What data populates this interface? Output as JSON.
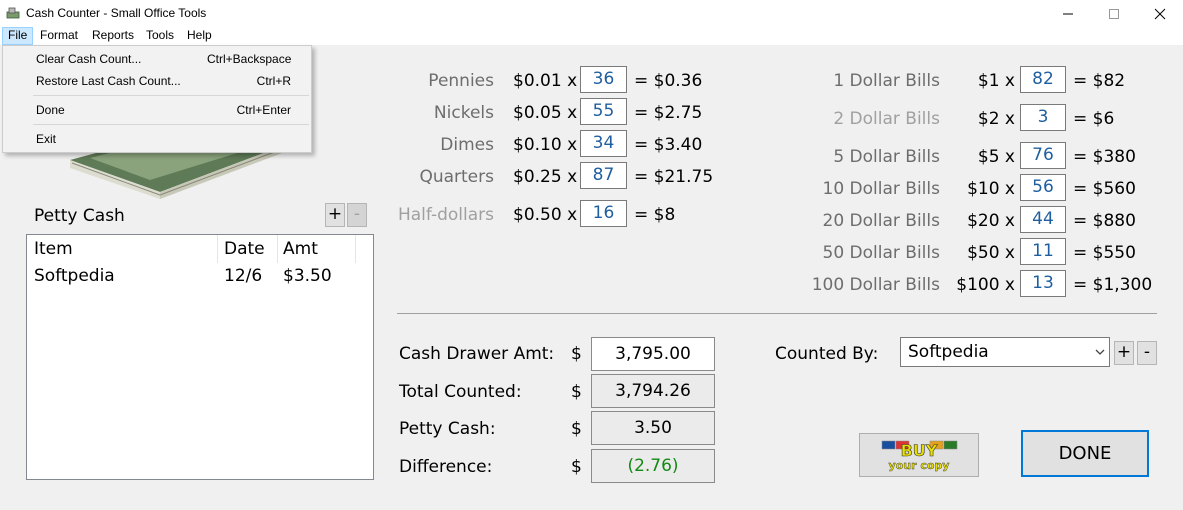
{
  "window": {
    "title": "Cash Counter - Small Office Tools"
  },
  "menubar": [
    "File",
    "Format",
    "Reports",
    "Tools",
    "Help"
  ],
  "file_menu": {
    "items": [
      {
        "label": "Clear Cash Count...",
        "shortcut": "Ctrl+Backspace"
      },
      {
        "label": "Restore Last Cash Count...",
        "shortcut": "Ctrl+R"
      },
      {
        "label": "Done",
        "shortcut": "Ctrl+Enter"
      },
      {
        "label": "Exit",
        "shortcut": ""
      }
    ]
  },
  "petty_cash": {
    "label": "Petty Cash",
    "add": "+",
    "remove": "-",
    "columns": [
      "Item",
      "Date",
      "Amt"
    ],
    "rows": [
      {
        "item": "Softpedia",
        "date": "12/6",
        "amt": "$3.50"
      }
    ]
  },
  "coins": [
    {
      "label": "Pennies",
      "price": "$0.01 x",
      "count": "36",
      "total": "= $0.36"
    },
    {
      "label": "Nickels",
      "price": "$0.05 x",
      "count": "55",
      "total": "= $2.75"
    },
    {
      "label": "Dimes",
      "price": "$0.10 x",
      "count": "34",
      "total": "= $3.40"
    },
    {
      "label": "Quarters",
      "price": "$0.25 x",
      "count": "87",
      "total": "= $21.75"
    },
    {
      "label": "Half-dollars",
      "price": "$0.50 x",
      "count": "16",
      "total": "= $8"
    }
  ],
  "bills": [
    {
      "label": "1 Dollar Bills",
      "price": "$1 x",
      "count": "82",
      "total": "= $82"
    },
    {
      "label": "2 Dollar Bills",
      "price": "$2 x",
      "count": "3",
      "total": "= $6"
    },
    {
      "label": "5 Dollar Bills",
      "price": "$5 x",
      "count": "76",
      "total": "= $380"
    },
    {
      "label": "10 Dollar Bills",
      "price": "$10 x",
      "count": "56",
      "total": "= $560"
    },
    {
      "label": "20 Dollar Bills",
      "price": "$20 x",
      "count": "44",
      "total": "= $880"
    },
    {
      "label": "50 Dollar Bills",
      "price": "$50 x",
      "count": "11",
      "total": "= $550"
    },
    {
      "label": "100 Dollar Bills",
      "price": "$100 x",
      "count": "13",
      "total": "= $1,300"
    }
  ],
  "summary": {
    "cash_drawer": {
      "label": "Cash Drawer Amt:",
      "dollar": "$",
      "value": "3,795.00"
    },
    "total_counted": {
      "label": "Total Counted:",
      "dollar": "$",
      "value": "3,794.26"
    },
    "petty_cash": {
      "label": "Petty Cash:",
      "dollar": "$",
      "value": "3.50"
    },
    "difference": {
      "label": "Difference:",
      "dollar": "$",
      "value": "(2.76)"
    }
  },
  "counted_by": {
    "label": "Counted By:",
    "value": "Softpedia",
    "add": "+",
    "remove": "-"
  },
  "buy_button": {
    "line1": "BUY",
    "line2": "your copy"
  },
  "done_button": "DONE",
  "colors": {
    "count_text": "#1f5f9f",
    "difference_text": "#138a13",
    "done_border": "#0078d7",
    "menu_highlight": "#cce8ff"
  }
}
